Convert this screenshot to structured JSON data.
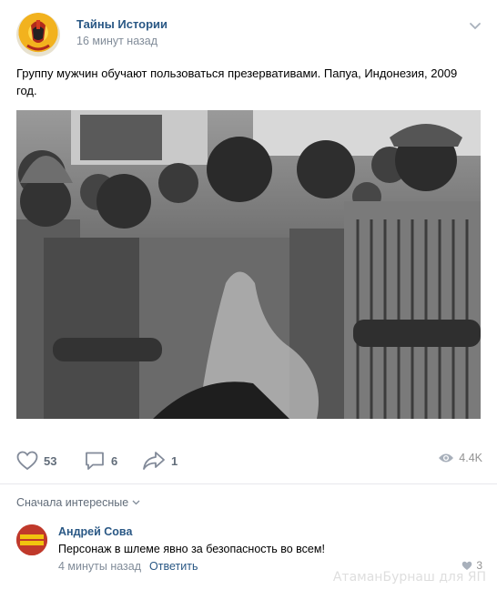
{
  "post": {
    "author": "Тайны Истории",
    "time": "16 минут назад",
    "text": "Группу мужчин обучают пользоваться презервативами. Папуа, Индонезия, 2009 год.",
    "photo_icon": "photo-black-white-group-of-men"
  },
  "actions": {
    "likes": "53",
    "comments": "6",
    "shares": "1",
    "views": "4.4K"
  },
  "comments_section": {
    "sort_label": "Сначала интересные",
    "comment": {
      "author": "Андрей Сова",
      "text": "Персонаж в шлеме явно за безопасность во всем!",
      "time": "4 минуты назад",
      "reply_label": "Ответить",
      "likes": "3"
    }
  },
  "watermark": "АтаманБурнаш для ЯП",
  "colors": {
    "link": "#2a5885",
    "muted": "#818c99",
    "icon": "#828a99"
  }
}
